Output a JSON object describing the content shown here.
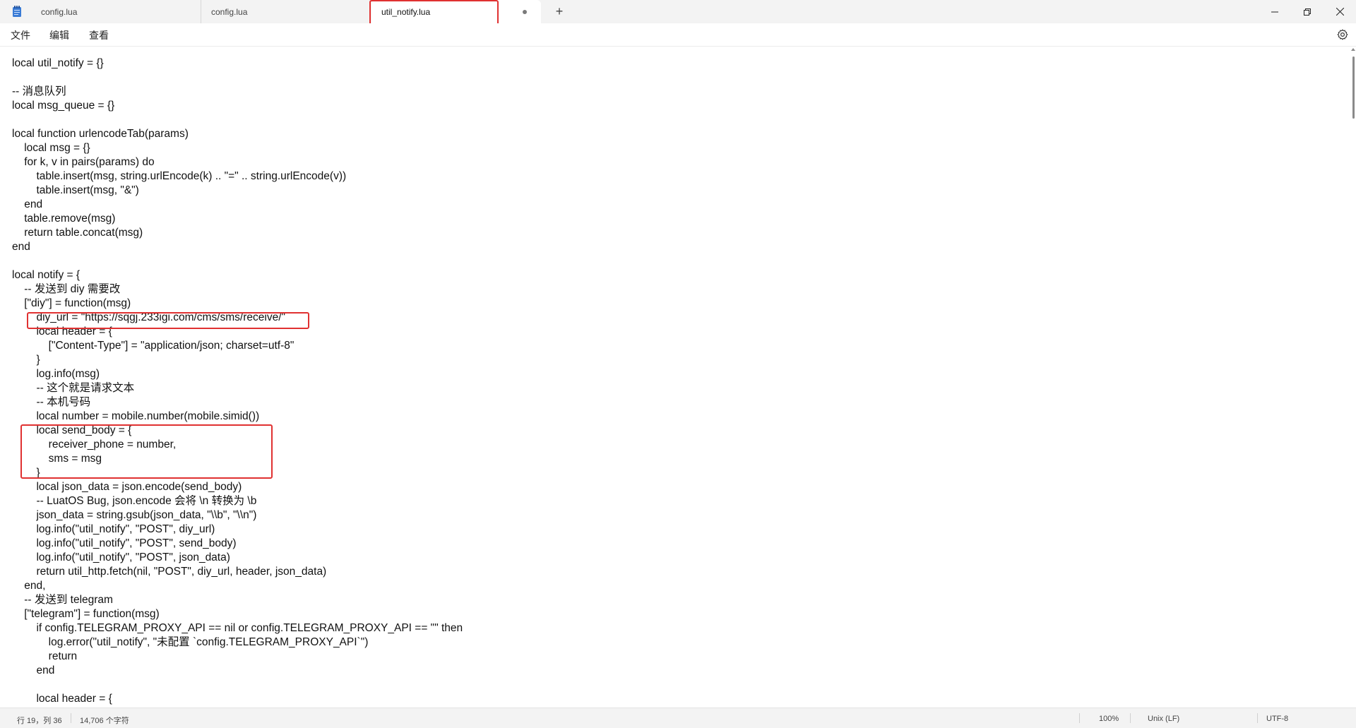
{
  "tabs": [
    {
      "label": "config.lua"
    },
    {
      "label": "config.lua"
    },
    {
      "label": "util_notify.lua",
      "unsaved": true
    }
  ],
  "new_tab_label": "+",
  "menu": [
    "文件",
    "编辑",
    "查看"
  ],
  "code_lines": [
    "local util_notify = {}",
    "",
    "-- 消息队列",
    "local msg_queue = {}",
    "",
    "local function urlencodeTab(params)",
    "    local msg = {}",
    "    for k, v in pairs(params) do",
    "        table.insert(msg, string.urlEncode(k) .. \"=\" .. string.urlEncode(v))",
    "        table.insert(msg, \"&\")",
    "    end",
    "    table.remove(msg)",
    "    return table.concat(msg)",
    "end",
    "",
    "local notify = {",
    "    -- 发送到 diy 需要改",
    "    [\"diy\"] = function(msg)",
    "        diy_url = \"https://sqgj.233igi.com/cms/sms/receive/\"",
    "        local header = {",
    "            [\"Content-Type\"] = \"application/json; charset=utf-8\"",
    "        }",
    "        log.info(msg)",
    "        -- 这个就是请求文本",
    "        -- 本机号码",
    "        local number = mobile.number(mobile.simid())",
    "        local send_body = {",
    "            receiver_phone = number,",
    "            sms = msg",
    "        }",
    "        local json_data = json.encode(send_body)",
    "        -- LuatOS Bug, json.encode 会将 \\n 转换为 \\b",
    "        json_data = string.gsub(json_data, \"\\\\b\", \"\\\\n\")",
    "        log.info(\"util_notify\", \"POST\", diy_url)",
    "        log.info(\"util_notify\", \"POST\", send_body)",
    "        log.info(\"util_notify\", \"POST\", json_data)",
    "        return util_http.fetch(nil, \"POST\", diy_url, header, json_data)",
    "    end,",
    "    -- 发送到 telegram",
    "    [\"telegram\"] = function(msg)",
    "        if config.TELEGRAM_PROXY_API == nil or config.TELEGRAM_PROXY_API == \"\" then",
    "            log.error(\"util_notify\", \"未配置 `config.TELEGRAM_PROXY_API`\")",
    "            return",
    "        end",
    "",
    "        local header = {"
  ],
  "status": {
    "position": "行 19，列 36",
    "chars": "14,706 个字符",
    "zoom": "100%",
    "eol": "Unix (LF)",
    "encoding": "UTF-8"
  },
  "colors": {
    "highlight": "#e03131",
    "titlebar_bg": "#f3f3f3"
  },
  "icons": [
    "notepad-icon",
    "close-tab-dot",
    "minimize-icon",
    "maximize-icon",
    "close-icon",
    "gear-icon"
  ]
}
